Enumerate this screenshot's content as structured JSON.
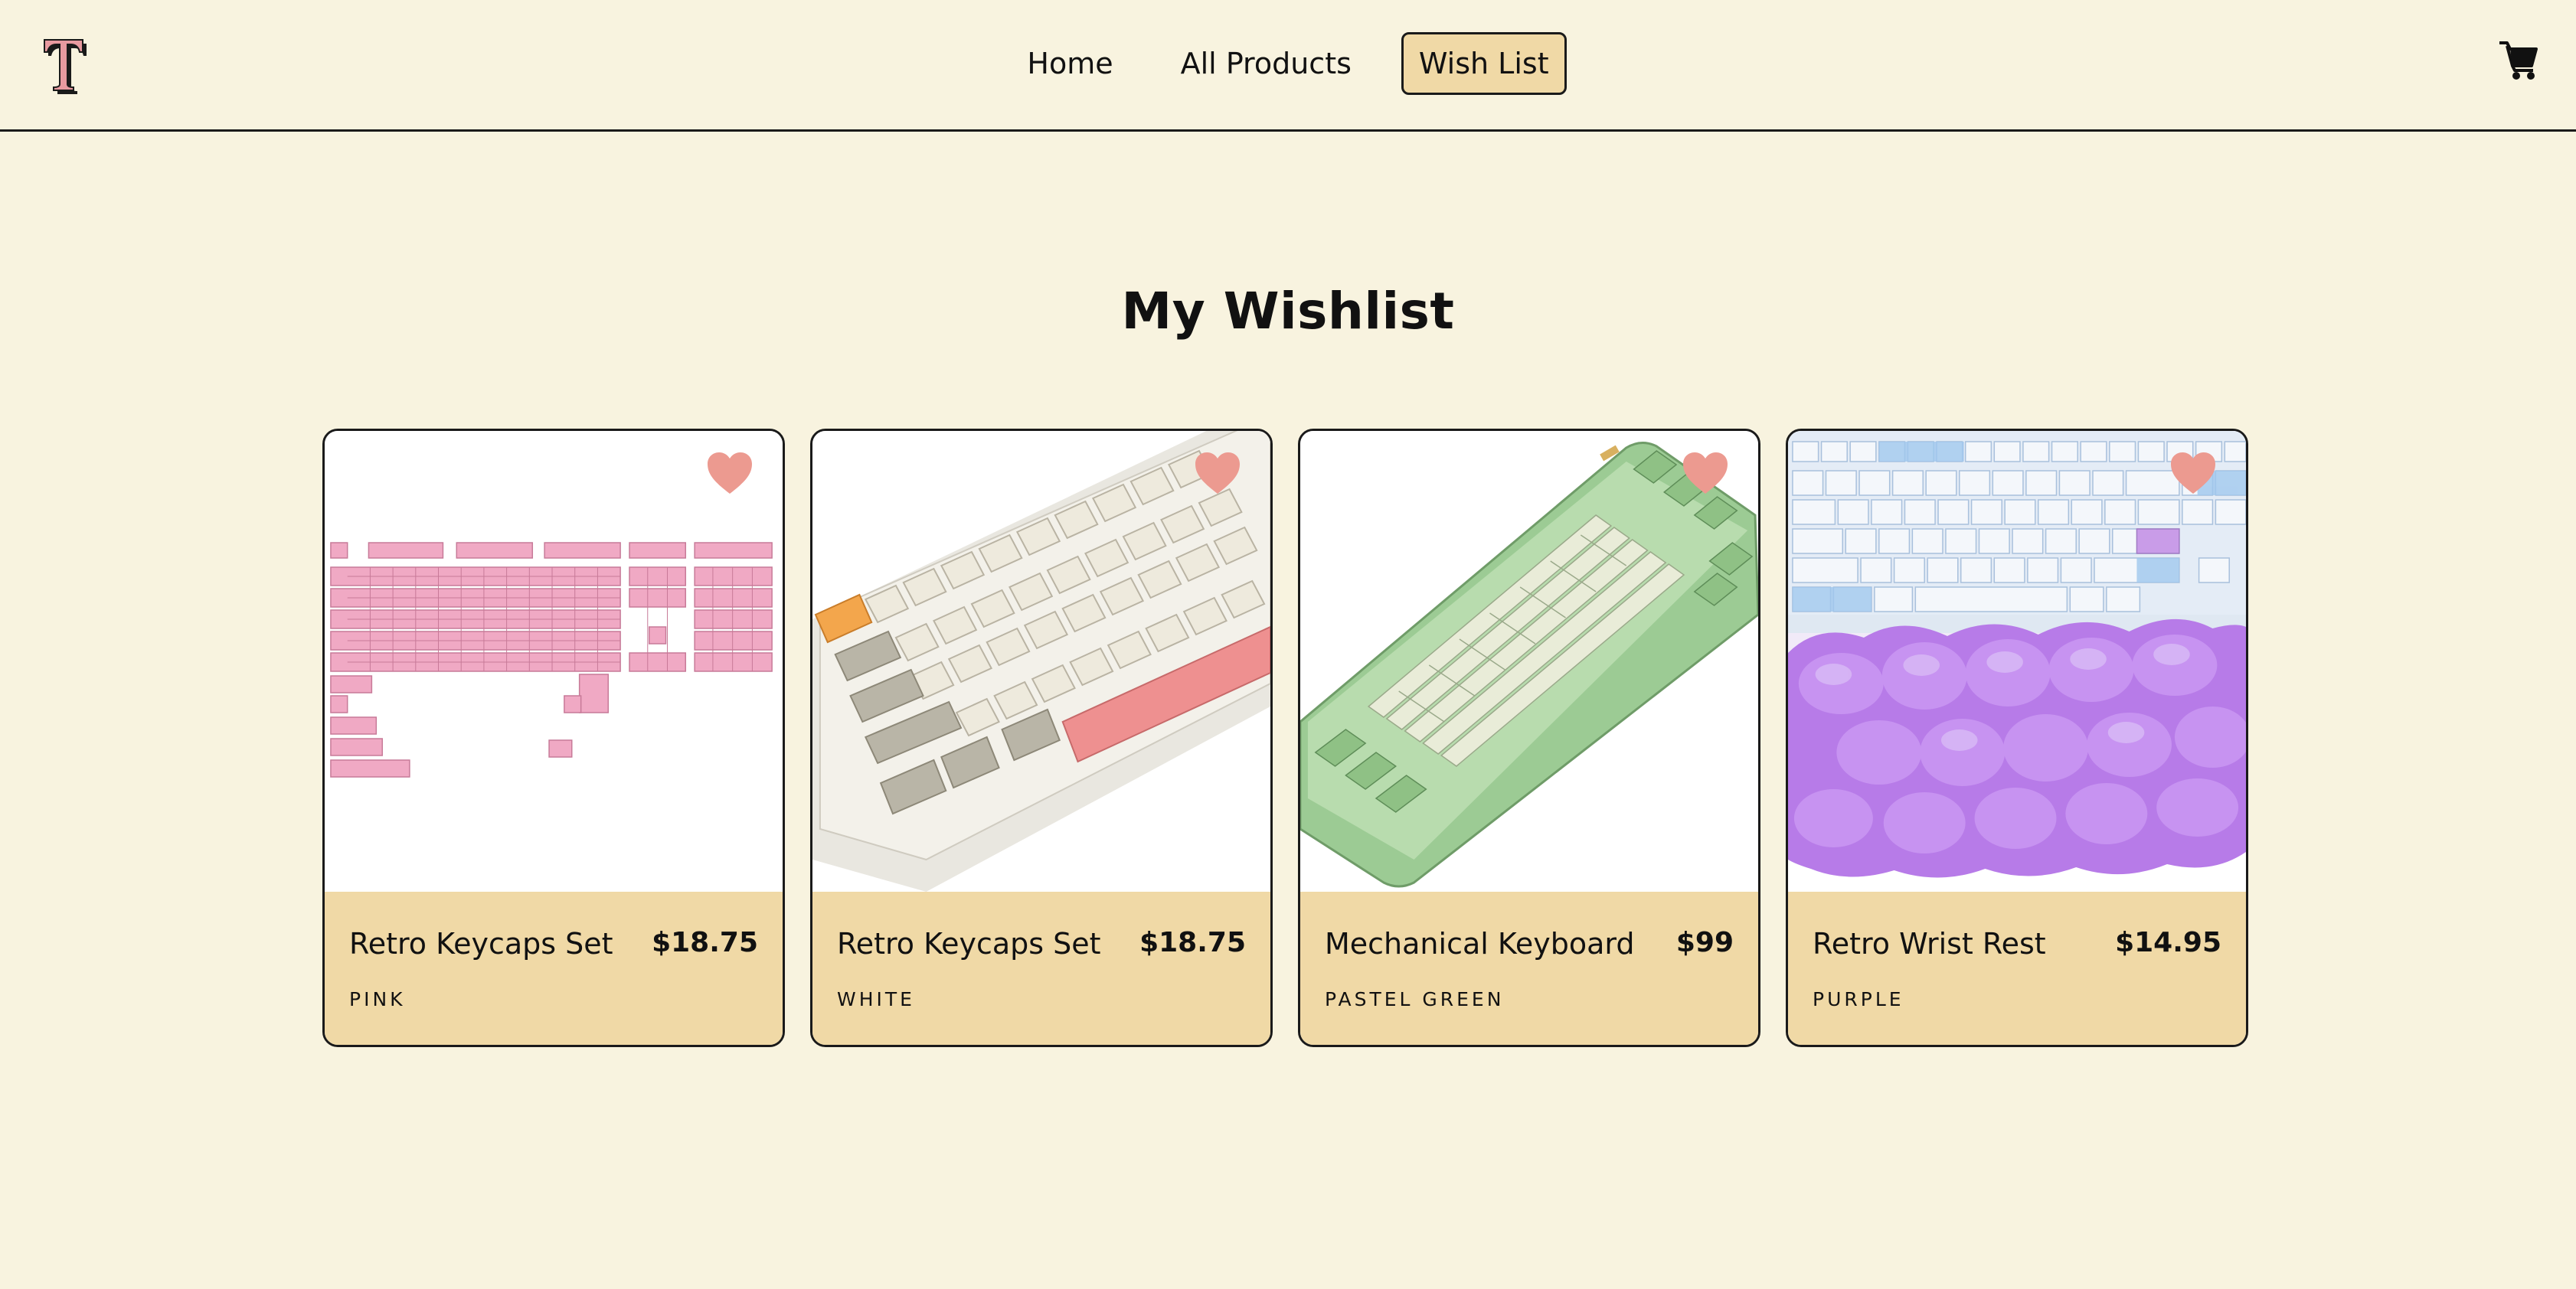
{
  "header": {
    "logo_letter": "T",
    "nav": [
      {
        "label": "Home",
        "active": false
      },
      {
        "label": "All Products",
        "active": false
      },
      {
        "label": "Wish List",
        "active": true
      }
    ],
    "cart_icon": "shopping-cart-icon"
  },
  "page": {
    "title": "My Wishlist"
  },
  "colors": {
    "background": "#f8f3df",
    "card_info": "#f0d9a6",
    "active_nav": "#f0d9a6",
    "heart": "#ec9a90",
    "logo": "#e89aa0"
  },
  "wishlist": [
    {
      "name": "Retro Keycaps Set",
      "price": "$18.75",
      "variant": "PINK",
      "icon": "heart-icon"
    },
    {
      "name": "Retro Keycaps Set",
      "price": "$18.75",
      "variant": "WHITE",
      "icon": "heart-icon"
    },
    {
      "name": "Mechanical Keyboard",
      "price": "$99",
      "variant": "PASTEL GREEN",
      "icon": "heart-icon"
    },
    {
      "name": "Retro Wrist Rest",
      "price": "$14.95",
      "variant": "PURPLE",
      "icon": "heart-icon"
    }
  ]
}
